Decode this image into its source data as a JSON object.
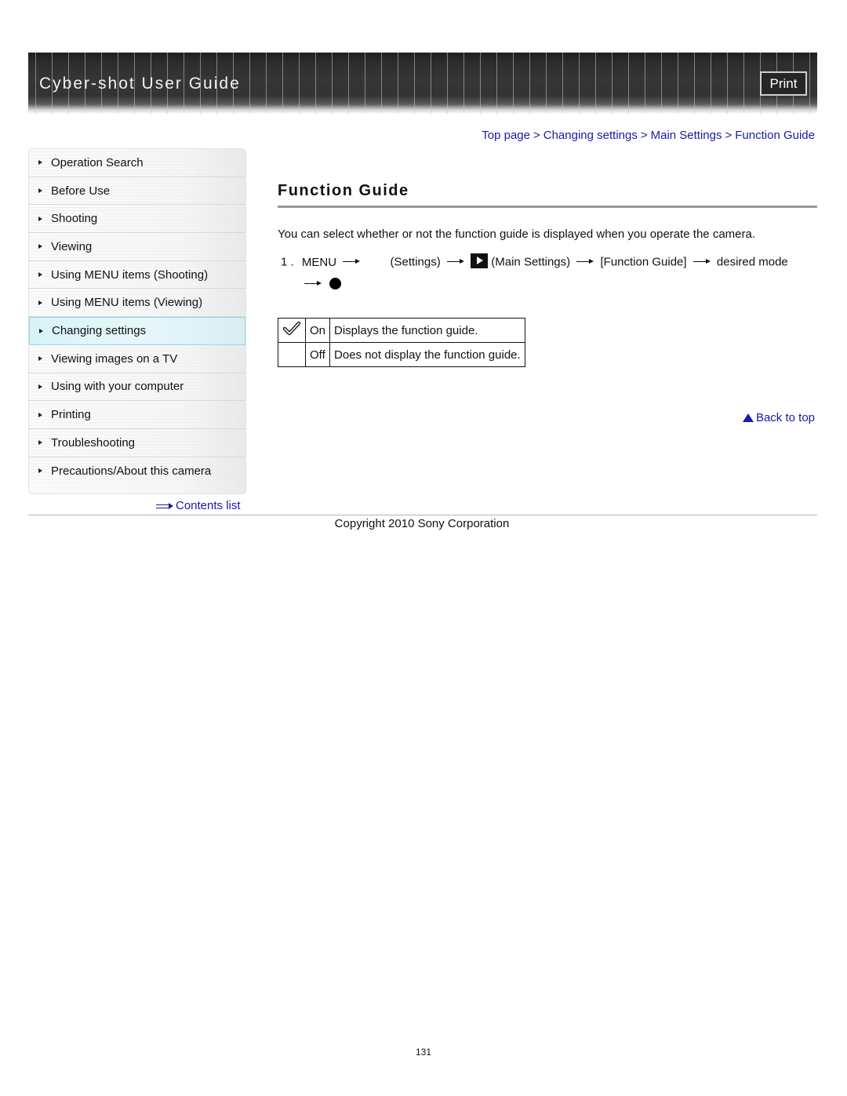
{
  "header": {
    "title": "Cyber-shot User Guide",
    "print_label": "Print"
  },
  "breadcrumb": [
    {
      "label": "Top page"
    },
    {
      "label": "Changing settings"
    },
    {
      "label": "Main Settings"
    },
    {
      "label": "Function Guide"
    }
  ],
  "breadcrumb_separator": ">",
  "sidebar": {
    "items": [
      {
        "label": "Operation Search",
        "active": false
      },
      {
        "label": "Before Use",
        "active": false
      },
      {
        "label": "Shooting",
        "active": false
      },
      {
        "label": "Viewing",
        "active": false
      },
      {
        "label": "Using MENU items (Shooting)",
        "active": false
      },
      {
        "label": "Using MENU items (Viewing)",
        "active": false
      },
      {
        "label": "Changing settings",
        "active": true
      },
      {
        "label": "Viewing images on a TV",
        "active": false
      },
      {
        "label": "Using with your computer",
        "active": false
      },
      {
        "label": "Printing",
        "active": false
      },
      {
        "label": "Troubleshooting",
        "active": false
      },
      {
        "label": "Precautions/About this camera",
        "active": false
      }
    ],
    "contents_link": "Contents list"
  },
  "main": {
    "title": "Function Guide",
    "intro": "You can select whether or not the function guide is displayed when you operate the camera.",
    "step": {
      "number": "1 .",
      "menu": "MENU",
      "settings": "(Settings)",
      "main_settings": "(Main Settings)",
      "function_guide": "[Function Guide]",
      "desired_mode": "desired mode",
      "icons": [
        "arrow-right-icon",
        "settings-icon",
        "arrow-right-icon",
        "play-icon",
        "arrow-right-icon",
        "arrow-right-icon",
        "arrow-right-icon",
        "ok-dot-icon"
      ]
    },
    "options": [
      {
        "icon": "checkmark-icon",
        "name": "On",
        "description": "Displays the function guide.",
        "default": true
      },
      {
        "icon": "",
        "name": "Off",
        "description": "Does not display the function guide.",
        "default": false
      }
    ],
    "back_to_top": "Back to top"
  },
  "footer": {
    "copyright": "Copyright 2010 Sony Corporation",
    "page_number": "131"
  },
  "colors": {
    "link": "#1a1aa6",
    "active_nav": "#d6f3f8",
    "active_nav_border": "#8fd8ec",
    "header_bg": "#333333"
  }
}
